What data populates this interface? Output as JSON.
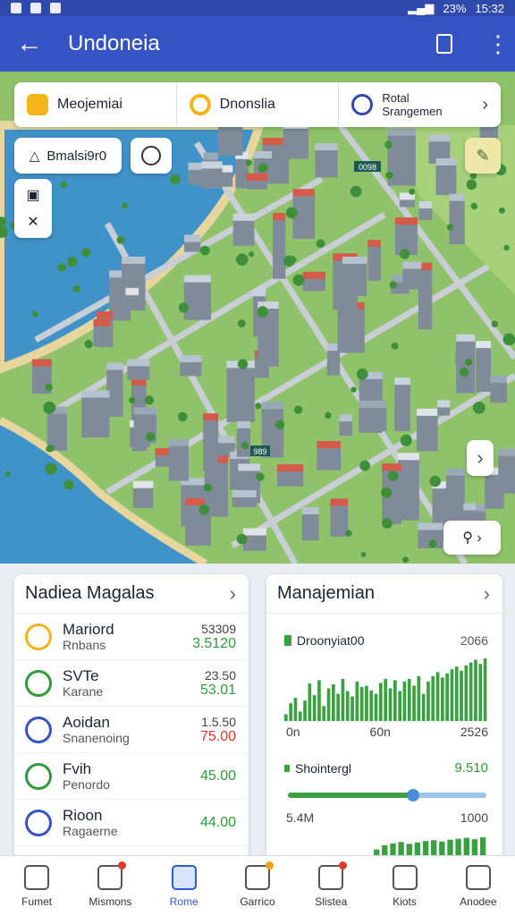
{
  "status_bar": {
    "right_text": "23%",
    "time": "15:32"
  },
  "app_bar": {
    "title": "Undoneia"
  },
  "filters": [
    {
      "label": "Meojemiai"
    },
    {
      "label": "Dnonslia"
    },
    {
      "line1": "Rotal",
      "line2": "Srangemen"
    }
  ],
  "map": {
    "location_label": "Bmalsi9r0",
    "labels": [
      "0098",
      "989"
    ]
  },
  "left_card": {
    "title": "Nadiea Magalas",
    "rows": [
      {
        "name": "Mariord",
        "sub": "Rnbans",
        "n1": "53309",
        "n2": "3.5120",
        "n2_color": "#2f9a3c",
        "icon_color": "#f0b21c"
      },
      {
        "name": "SVTe",
        "sub": "Karane",
        "n1": "23.50",
        "n2": "53.01",
        "n2_color": "#2f9a3c",
        "icon_color": "#2f9a3c"
      },
      {
        "name": "Aoidan",
        "sub": "Snanenoing",
        "n1": "1.5.50",
        "n2": "75.00",
        "n2_color": "#e0362b",
        "icon_color": "#3553c2"
      },
      {
        "name": "Fvih",
        "sub": "Penordo",
        "n1": "",
        "n2": "45.00",
        "n2_color": "#2f9a3c",
        "icon_color": "#2f9a3c"
      },
      {
        "name": "Rioon",
        "sub": "Ragaerne",
        "n1": "",
        "n2": "44.00",
        "n2_color": "#2f9a3c",
        "icon_color": "#3553c2"
      }
    ]
  },
  "right_card": {
    "title": "Manajemian",
    "chart1_label": "Droonyiat00",
    "chart1_value": "2066",
    "axis": [
      "0n",
      "60n",
      "2526"
    ],
    "stat_label": "Shointergl",
    "stat_value": "9.510",
    "progress": 0.63,
    "range_min": "5.4M",
    "range_max": "1000"
  },
  "chart_data": {
    "type": "bar",
    "series": [
      {
        "values": [
          10,
          26,
          34,
          14,
          30,
          55,
          38,
          60,
          22,
          48,
          54,
          40,
          62,
          44,
          36,
          58,
          50,
          52,
          45,
          40,
          56,
          62,
          48,
          60,
          44,
          58,
          62,
          52,
          66,
          40,
          58,
          66,
          72,
          64,
          70,
          76,
          80,
          74,
          82,
          86,
          90,
          84,
          92
        ]
      }
    ]
  },
  "bottom_nav": [
    {
      "label": "Fumet",
      "active": false
    },
    {
      "label": "Mismons",
      "active": false,
      "badge": "red"
    },
    {
      "label": "Rome",
      "active": true
    },
    {
      "label": "Garrico",
      "active": false,
      "badge": "orange"
    },
    {
      "label": "Slistea",
      "active": false,
      "badge": "red"
    },
    {
      "label": "Kiots",
      "active": false
    },
    {
      "label": "Anodee",
      "active": false
    }
  ],
  "colors": {
    "primary": "#3553c2",
    "green": "#2f9a3c",
    "red": "#e0362b"
  }
}
